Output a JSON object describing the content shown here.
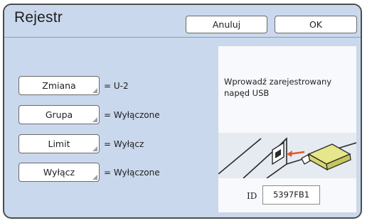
{
  "header": {
    "title": "Rejestr",
    "cancel_label": "Anuluj",
    "ok_label": "OK"
  },
  "settings": [
    {
      "label": "Zmiana",
      "value": "= U-2"
    },
    {
      "label": "Grupa",
      "value": "= Wyłączone"
    },
    {
      "label": "Limit",
      "value": "= Wyłącz"
    },
    {
      "label": "Wyłącz",
      "value": "= Wyłączone"
    }
  ],
  "panel": {
    "instruction": "Wprowadź zarejestrowany napęd USB",
    "id_label": "ID",
    "id_value": "5397FB1"
  },
  "colors": {
    "background": "#c9d8ec",
    "panel": "#f7f9fc",
    "usb_body": "#e6e68a",
    "arrow": "#e05a2b"
  },
  "icons": {
    "usb": "usb-drive-icon",
    "arrow": "arrow-left-icon"
  }
}
